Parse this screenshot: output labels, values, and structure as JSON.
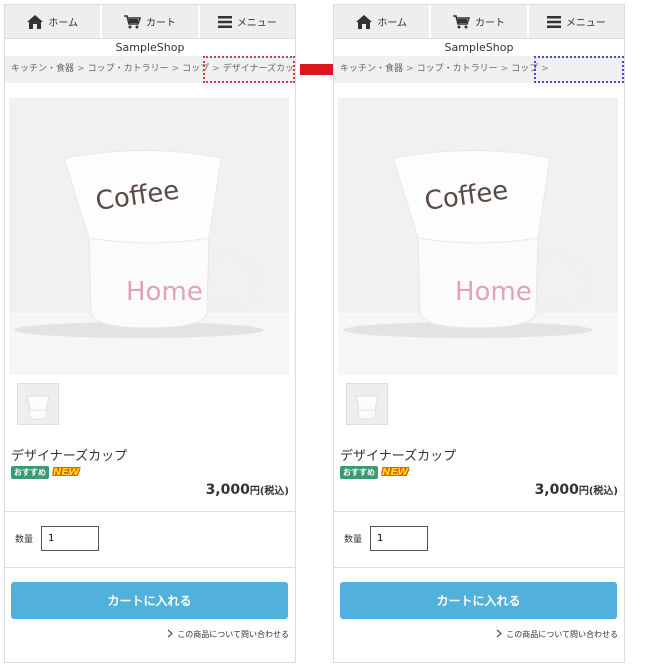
{
  "nav": {
    "home": "ホーム",
    "cart": "カート",
    "menu": "メニュー"
  },
  "shop_name": "SampleShop",
  "breadcrumb": {
    "items": [
      "キッチン・食器",
      "コップ・カトラリー",
      "コップ",
      "デザイナーズカップ"
    ],
    "separator": ">"
  },
  "image": {
    "cup_top_text": "Coffee",
    "cup_bottom_text": "Home"
  },
  "product": {
    "name": "デザイナーズカップ",
    "badge_recommend": "おすすめ",
    "badge_new": "NEW",
    "price": "3,000",
    "price_unit": "円",
    "tax": "(税込)"
  },
  "quantity": {
    "label": "数量",
    "value": "1"
  },
  "cart_button": "カートに入れる",
  "inquiry_link": "この商品について問い合わせる",
  "colors": {
    "highlight_red": "#e0344a",
    "highlight_blue": "#3b4fd2",
    "arrow": "#d9181e",
    "cart_button": "#52b0dd"
  }
}
